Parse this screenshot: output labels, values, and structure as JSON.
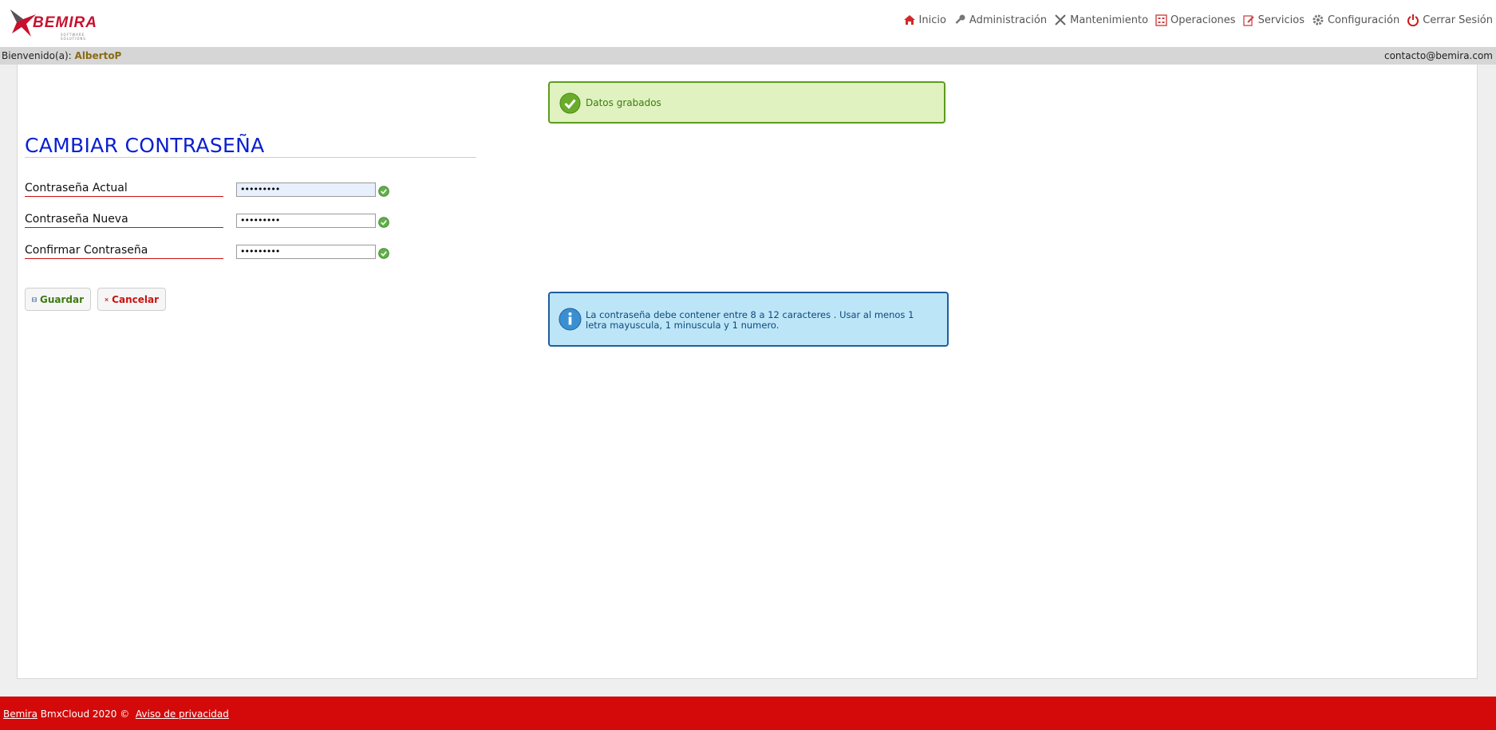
{
  "brand": {
    "logo_text": "BEMIRA",
    "logo_sub": "SOFTWARE SOLUTIONS"
  },
  "nav": {
    "items": [
      {
        "label": "Inicio",
        "icon": "home-icon"
      },
      {
        "label": "Administración",
        "icon": "key-icon"
      },
      {
        "label": "Mantenimiento",
        "icon": "tools-icon"
      },
      {
        "label": "Operaciones",
        "icon": "calculator-icon"
      },
      {
        "label": "Servicios",
        "icon": "edit-icon"
      },
      {
        "label": "Configuración",
        "icon": "gear-icon"
      },
      {
        "label": "Cerrar Sesión",
        "icon": "power-icon"
      }
    ]
  },
  "userbar": {
    "welcome": "Bienvenido(a):",
    "username": "AlbertoP",
    "email": "contacto@bemira.com"
  },
  "alerts": {
    "success": "Datos grabados",
    "info": "La contraseña debe contener entre 8 a 12 caracteres . Usar al menos 1 letra mayuscula, 1 minuscula y 1 numero."
  },
  "form": {
    "title": "CAMBIAR CONTRASEÑA",
    "fields": [
      {
        "label": "Contraseña Actual",
        "value": "•••••••••"
      },
      {
        "label": "Contraseña Nueva",
        "value": "•••••••••"
      },
      {
        "label": "Confirmar Contraseña",
        "value": "•••••••••"
      }
    ],
    "save_label": "Guardar",
    "cancel_label": "Cancelar"
  },
  "footer": {
    "brand_link": "Bemira",
    "text": "BmxCloud 2020 ©",
    "privacy_link": "Aviso de privacidad"
  },
  "colors": {
    "brand_red": "#d40a0a",
    "title_blue": "#0a1fd1",
    "success_green": "#5c9b1f",
    "info_blue": "#1f5e9a"
  }
}
